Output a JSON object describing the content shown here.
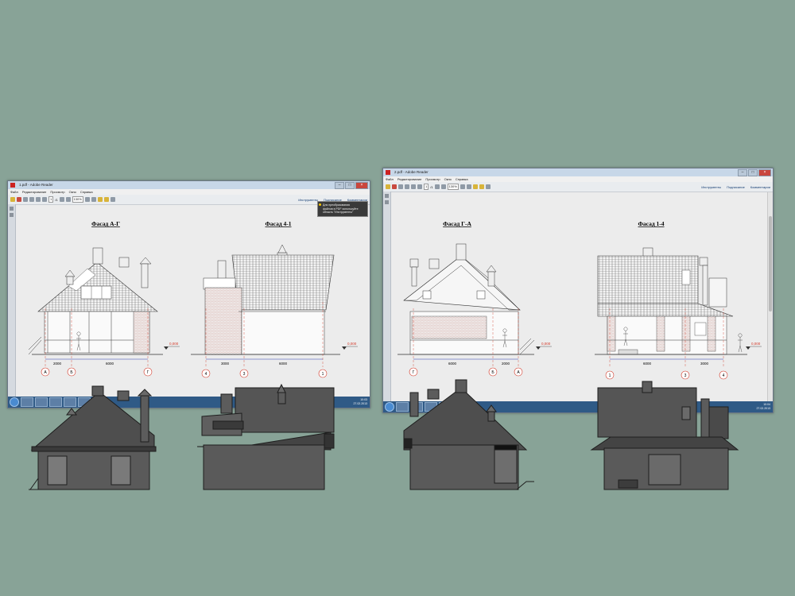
{
  "windows": [
    {
      "title": "1.pdf - Adobe Reader",
      "menu": [
        "Файл",
        "Редактирование",
        "Просмотр",
        "Окно",
        "Справка"
      ],
      "page_field": "1",
      "page_total": "/1",
      "zoom": "130%",
      "right_tabs": [
        "Инструменты",
        "Подписание",
        "Комментарии"
      ],
      "tooltip": [
        "Для преобразования",
        "файлов в PDF используйте",
        "область \"Инструменты\""
      ],
      "clock_time": "10:03",
      "clock_date": "27.02.2013"
    },
    {
      "title": "2.pdf - Adobe Reader",
      "menu": [
        "Файл",
        "Редактирование",
        "Просмотр",
        "Окно",
        "Справка"
      ],
      "page_field": "1",
      "page_total": "/1",
      "zoom": "130%",
      "right_tabs": [
        "Инструменты",
        "Подписание",
        "Комментарии"
      ],
      "clock_time": "10:04",
      "clock_date": "27.02.2013"
    }
  ],
  "drawings": {
    "fasad_a_g": {
      "title": "Фасад А-Г",
      "dims": [
        "2000",
        "6000"
      ],
      "axes": [
        "А",
        "Б",
        "Г"
      ],
      "level": "0,000"
    },
    "fasad_4_1": {
      "title": "Фасад 4-1",
      "dims": [
        "3000",
        "6000"
      ],
      "axes": [
        "4",
        "3",
        "1"
      ],
      "level": "0,000"
    },
    "fasad_g_a": {
      "title": "Фасад Г-А",
      "dims": [
        "6000",
        "2000"
      ],
      "axes": [
        "Г",
        "Б",
        "А"
      ],
      "level": "0,000"
    },
    "fasad_1_4": {
      "title": "Фасад 1-4",
      "dims": [
        "6000",
        "3000"
      ],
      "axes": [
        "1",
        "3",
        "4"
      ],
      "level": "0,000"
    }
  },
  "colors": {
    "background": "#88a397",
    "model_fill": "#5a5a5a",
    "model_edge": "#1e1e1e",
    "axis_red": "#d23a2a",
    "dim_blue": "#2a3fb0"
  },
  "icons": [
    "window-app-icon",
    "minimize-icon",
    "maximize-icon",
    "close-icon",
    "start-icon",
    "tooltip-bulb-icon"
  ]
}
